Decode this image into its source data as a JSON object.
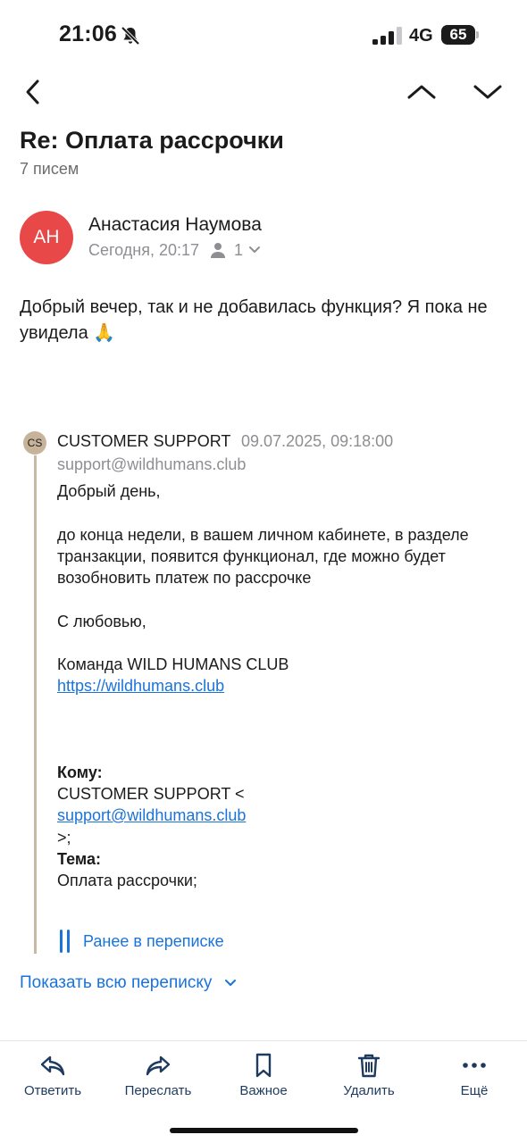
{
  "status_bar": {
    "time": "21:06",
    "network": "4G",
    "battery": "65",
    "icons": [
      "bell-slash-icon",
      "signal-icon"
    ]
  },
  "nav": {
    "icons": [
      "chevron-left-icon",
      "chevron-up-icon",
      "chevron-down-icon"
    ]
  },
  "thread": {
    "title": "Re: Оплата рассрочки",
    "count": "7 писем"
  },
  "message": {
    "avatar_initials": "АН",
    "avatar_color": "#e94848",
    "sender": "Анастасия Наумова",
    "time": "Сегодня, 20:17",
    "recipients": "1",
    "body": "Добрый вечер, так и не добавилась функция? Я пока не увидела 🙏"
  },
  "quoted": {
    "avatar_initials": "CS",
    "sender": "CUSTOMER SUPPORT",
    "date": "09.07.2025, 09:18:00",
    "email": "support@wildhumans.club",
    "greeting": "Добрый день,",
    "line1": "до конца недели, в вашем личном кабинете, в разделе",
    "line2": "транзакции,  появится  функционал, где можно будет",
    "line3": "возобновить платеж по рассрочке",
    "closing": "С любовью,",
    "team": "Команда WILD HUMANS CLUB",
    "link": "https://wildhumans.club",
    "to_label": "Кому:",
    "to_name": "CUSTOMER SUPPORT <",
    "to_email": "support@wildhumans.club",
    "to_end": ">;",
    "subject_label": "Тема:",
    "subject": "Оплата рассрочки;"
  },
  "earlier_label": "Ранее в переписке",
  "show_all_label": "Показать всю переписку",
  "toolbar": {
    "reply": "Ответить",
    "forward": "Переслать",
    "important": "Важное",
    "delete": "Удалить",
    "more": "Ещё"
  },
  "colors": {
    "accent": "#1a73d9",
    "quote_bar": "#c8b8a4",
    "toolbar_icon": "#1e3a5f"
  }
}
